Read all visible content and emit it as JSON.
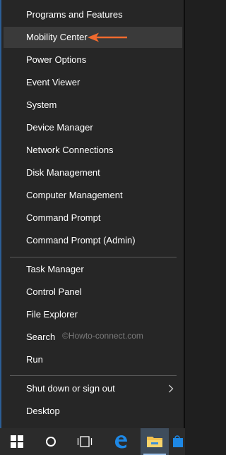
{
  "menu": {
    "items": [
      {
        "label": "Programs and Features"
      },
      {
        "label": "Mobility Center"
      },
      {
        "label": "Power Options"
      },
      {
        "label": "Event Viewer"
      },
      {
        "label": "System"
      },
      {
        "label": "Device Manager"
      },
      {
        "label": "Network Connections"
      },
      {
        "label": "Disk Management"
      },
      {
        "label": "Computer Management"
      },
      {
        "label": "Command Prompt"
      },
      {
        "label": "Command Prompt (Admin)"
      },
      {
        "label": "Task Manager"
      },
      {
        "label": "Control Panel"
      },
      {
        "label": "File Explorer"
      },
      {
        "label": "Search"
      },
      {
        "label": "Run"
      },
      {
        "label": "Shut down or sign out"
      },
      {
        "label": "Desktop"
      }
    ]
  },
  "watermark": "©Howto-connect.com",
  "taskbar": {
    "icons": [
      "windows-start-icon",
      "cortana-circle-icon",
      "task-view-icon",
      "edge-icon",
      "file-explorer-icon",
      "store-icon"
    ]
  },
  "colors": {
    "menu_bg": "#262626",
    "highlight": "#3a3a3a",
    "arrow": "#f06a2e",
    "accent": "#2c5e95"
  }
}
